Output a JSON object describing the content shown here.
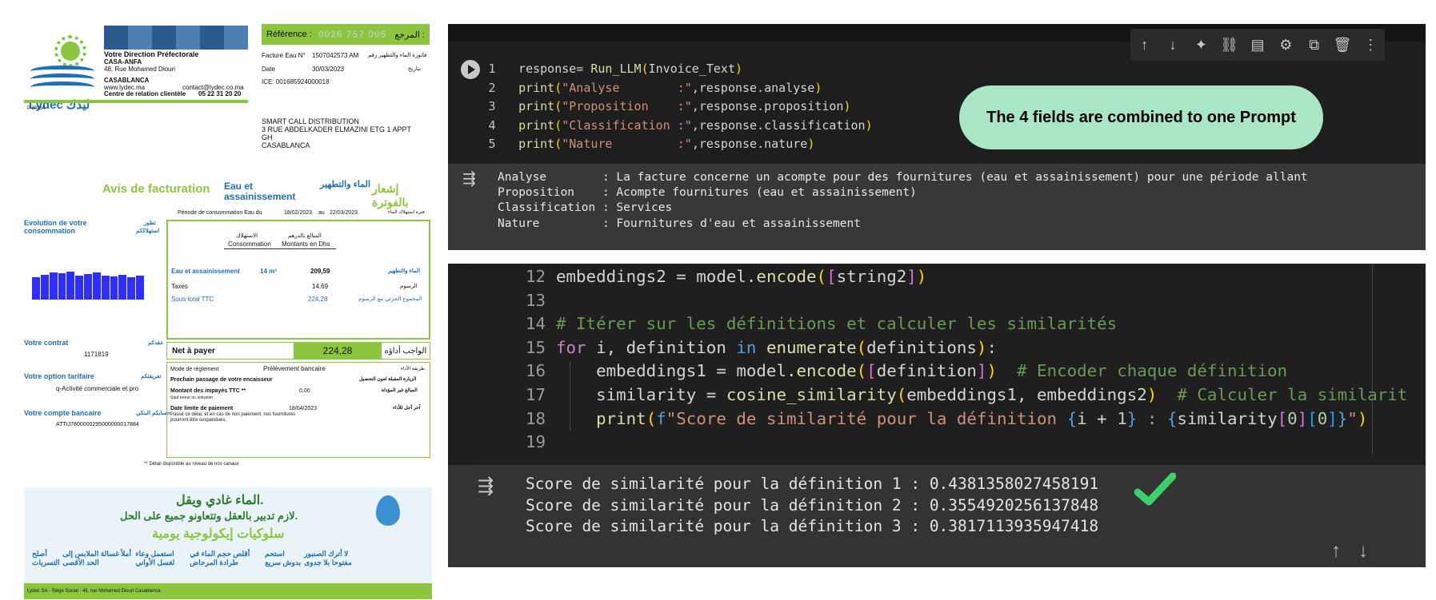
{
  "invoice": {
    "brand": "Lydec ليدك",
    "direction_title": "Votre Direction Préfectorale",
    "direction_name": "CASA-ANFA",
    "direction_address": "48, Rue Mohamed Diouri",
    "city": "CASABLANCA",
    "website": "www.lydec.ma",
    "email": "contact@lydec.co.ma",
    "client_center_label": "Centre de relation clientèle",
    "client_center_phone": "05 22 31 20 20",
    "doc_code": "P 20284",
    "reference_label": "Référence :",
    "reference_number": "0026  757  005",
    "reference_label_ar": "المرجع :",
    "facture_label": "Facture Eau N°",
    "facture_number": "1507042573 AM",
    "facture_label_ar": "فاتورة الماء والتطهير رقم",
    "date_label": "Date",
    "date_value": "30/03/2023",
    "date_label_ar": "بتاريخ",
    "ice": "ICE: 001685924000018",
    "recipient_1": "SMART CALL DISTRIBUTION",
    "recipient_2": "3 RUE ABDELKADER ELMAZINI ETG 1 APPT",
    "recipient_3": "GH",
    "recipient_4": "CASABLANCA",
    "avis_title": "Avis de facturation",
    "avis_sub": "Eau et assainissement",
    "avis_sub_ar": "الماء والتطهير",
    "avis_title_ar": "إشعار بالفوترة",
    "periode": "Période de consommation Eau   du",
    "periode_from": "18/02/2023",
    "periode_au": "au",
    "periode_to": "22/03/2023",
    "periode_ar": "فترة استهلاك الماء",
    "evolution_1": "Evolution de votre",
    "evolution_2": "consommation",
    "evolution_ar_1": "تطور",
    "evolution_ar_2": "استهلاككم",
    "col_consommation_ar": "الاستهلاك",
    "col_consommation": "Consommation",
    "col_montants_ar": "المبالغ بالدرهم",
    "col_montants": "Montants en Dhs",
    "row_eau_label": "Eau et assainissement",
    "row_eau_qty": "14  m³",
    "row_eau_amount": "209,59",
    "row_eau_ar": "الماء والتطهير",
    "row_taxes_label": "Taxes",
    "row_taxes_amount": "14,69",
    "row_taxes_ar": "الرسوم",
    "row_sous_label": "Sous total TTC",
    "row_sous_amount": "224,28",
    "row_sous_ar": "المجموع الجزئي مع الرسوم",
    "net_label": "Net à payer",
    "net_amount": "224,28",
    "net_ar": "الواجب أداؤه",
    "contrat_label": "Votre contrat",
    "contrat_ar": "عقدكم",
    "contrat_number": "1171819",
    "option_label": "Votre option tarifaire",
    "option_ar": "تعريفتكم",
    "option_value": "q-Activité commerciale et pro",
    "compte_label": "Votre compte bancaire",
    "compte_ar": "حسابكم البنكي",
    "compte_number": "ATTIJ7800000295000000017884",
    "reglement_label": "Mode de règlement",
    "reglement_value": "Prélèvement bancaire",
    "reglement_ar": "طريقة الأداء",
    "passage_label": "Prochain passage de votre encaisseur",
    "passage_ar": "الزيارة المقبلة لعون التحصيل",
    "impayes_label": "Montant des impayés TTC   **",
    "impayes_value": "0,00",
    "impayes_ar": "المبالغ غير المؤداة",
    "sauf_erreur": "Sauf erreur ou omission",
    "limite_label": "Date limite de paiement",
    "limite_value": "18/04/2023",
    "limite_ar": "آخر أجل للأداء",
    "limite_note": "Passé ce délai, et en cas de non paiement, nos fournitures pourront être suspendues.",
    "detail_note": "** Détail disponible au niveau de nos canaux",
    "promo_1": "الماء غادي ويقل.",
    "promo_2": "لازم تدبير بالعقل وتتعاونو جميع على الحل.",
    "promo_3": "سلوكيات إيكولوجية يومية",
    "tips": [
      "أصلح التسربات",
      "أملأ غسالة الملابس إلى الحد الأقصى",
      "استعمل وعاء لغسل الأواني",
      "أقلص حجم الماء في طرادة المرحاض",
      "استحم بدوش سريع",
      "لا أترك الصنبور مفتوحا بلا جدوى"
    ],
    "footer": "Lydec SA - Siège Social : 48, rue Mohamed Diouri Casablanca"
  },
  "notebook1": {
    "toolbar_icons": [
      "arrow-up-icon",
      "arrow-down-icon",
      "sparkle-icon",
      "link-icon",
      "comment-icon",
      "gear-icon",
      "mirror-cell-icon",
      "trash-icon",
      "more-vert-icon"
    ],
    "annotation": "The 4 fields are combined to one Prompt",
    "output": [
      "Analyse        : La facture concerne un acompte pour des fournitures (eau et assainissement) pour une période allant",
      "Proposition    : Acompte fournitures (eau et assainissement)",
      "Classification : Services",
      "Nature         : Fournitures d'eau et assainissement"
    ]
  },
  "notebook2": {
    "output": [
      "Score de similarité pour la définition 1 : 0.4381358027458191",
      "Score de similarité pour la définition 2 : 0.3554920256137848",
      "Score de similarité pour la définition 3 : 0.3817113935947418"
    ],
    "check_color": "#3ecf6b"
  }
}
